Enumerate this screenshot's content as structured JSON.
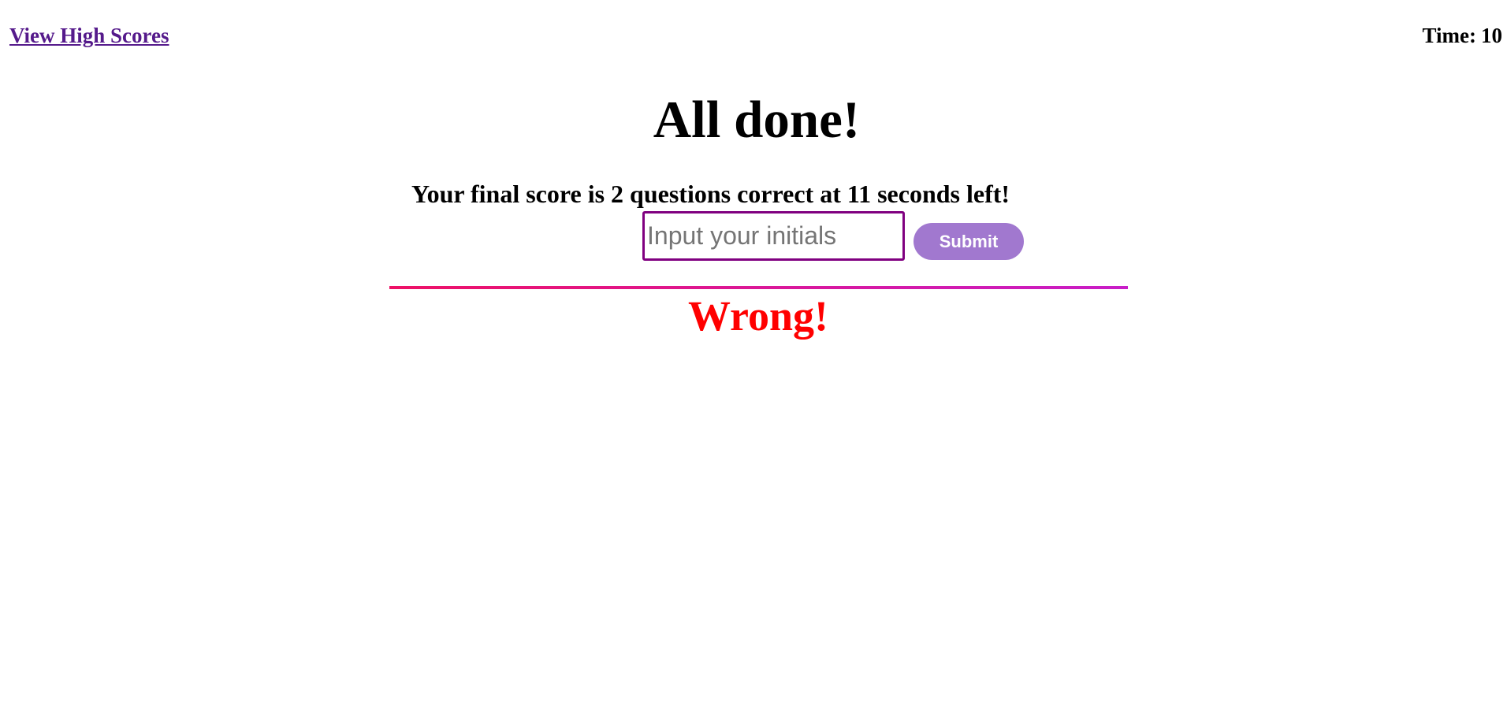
{
  "nav": {
    "high_scores_label": "View High Scores"
  },
  "timer": {
    "label": "Time:",
    "value": "10"
  },
  "end_screen": {
    "title": "All done!",
    "score_message": "Your final score is 2 questions correct at 11 seconds left!",
    "initials_placeholder": "Input your initials",
    "initials_value": "",
    "submit_label": "Submit"
  },
  "feedback": {
    "text": "Wrong!"
  },
  "colors": {
    "link": "#551a8b",
    "input_border": "#800080",
    "submit_bg": "#a178cf",
    "divider_start": "#ee1166",
    "divider_end": "#c81dc8",
    "feedback_wrong": "#ff0000"
  }
}
